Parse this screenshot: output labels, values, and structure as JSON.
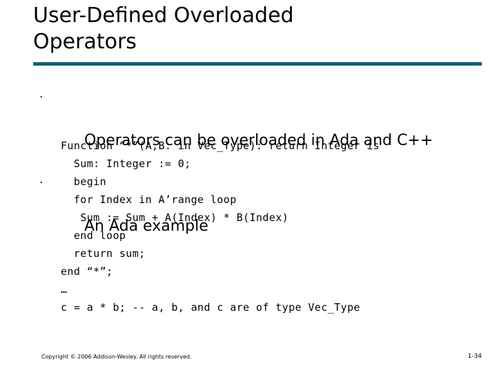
{
  "slide": {
    "title": "User-Defined Overloaded\nOperators",
    "rule_color": "#14607f",
    "background_color": "#ffffff",
    "text_color": "#000000"
  },
  "bullets": [
    {
      "marker": "·",
      "text": "Operators can be overloaded in Ada and C++"
    },
    {
      "marker": "·",
      "text": "An Ada example"
    }
  ],
  "code": {
    "lines": [
      "Function “*”(A,B: in Vec_Type): return Integer is",
      "  Sum: Integer := 0;",
      "  begin",
      "  for Index in A’range loop",
      "   Sum := Sum + A(Index) * B(Index)",
      "  end loop",
      "  return sum;",
      "end “*”;",
      "…",
      "c = a * b; -- a, b, and c are of type Vec_Type"
    ]
  },
  "footer": {
    "copyright": "Copyright © 2006 Addison-Wesley. All rights reserved.",
    "page_number": "1-34"
  }
}
